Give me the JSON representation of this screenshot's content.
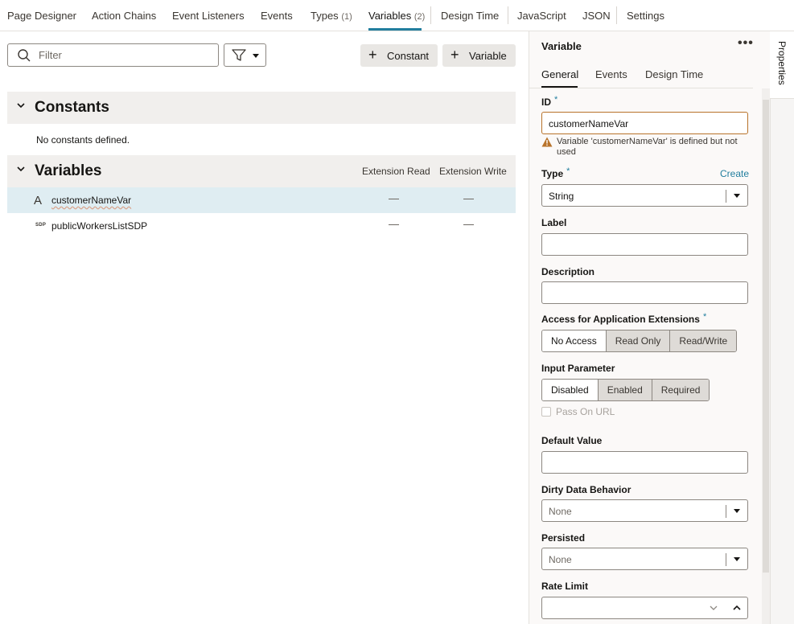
{
  "top_tabs": [
    {
      "label": "Page Designer",
      "count": ""
    },
    {
      "label": "Action Chains",
      "count": ""
    },
    {
      "label": "Event Listeners",
      "count": ""
    },
    {
      "label": "Events",
      "count": ""
    },
    {
      "label": "Types",
      "count": "(1)"
    },
    {
      "label": "Variables",
      "count": "(2)"
    },
    {
      "label": "Design Time",
      "count": ""
    },
    {
      "label": "JavaScript",
      "count": ""
    },
    {
      "label": "JSON",
      "count": ""
    },
    {
      "label": "Settings",
      "count": ""
    }
  ],
  "active_tab": "Variables",
  "toolbar": {
    "filter_placeholder": "Filter",
    "constant_button": "Constant",
    "variable_button": "Variable"
  },
  "constants": {
    "title": "Constants",
    "empty_text": "No constants defined."
  },
  "variables": {
    "title": "Variables",
    "col_read": "Extension Read",
    "col_write": "Extension Write",
    "rows": [
      {
        "icon": "A",
        "name": "customerNameVar",
        "selected": true
      },
      {
        "icon": "SDP",
        "name": "publicWorkersListSDP",
        "selected": false
      }
    ]
  },
  "properties": {
    "title": "Variable",
    "menu": "•••",
    "tabs": [
      "General",
      "Events",
      "Design Time"
    ],
    "id_label": "ID",
    "required_mark": "*",
    "id_value": "customerNameVar",
    "warning": "Variable 'customerNameVar' is defined but not used",
    "type_label": "Type",
    "create_link": "Create",
    "type_value": "String",
    "label_label": "Label",
    "label_value": "",
    "description_label": "Description",
    "description_value": "",
    "access_label": "Access for Application Extensions",
    "access_options": [
      "No Access",
      "Read Only",
      "Read/Write"
    ],
    "access_selected": "No Access",
    "input_param_label": "Input Parameter",
    "input_param_options": [
      "Disabled",
      "Enabled",
      "Required"
    ],
    "input_param_selected": "Disabled",
    "pass_on_url": "Pass On URL",
    "default_value_label": "Default Value",
    "default_value": "",
    "dirty_label": "Dirty Data Behavior",
    "dirty_value": "None",
    "persisted_label": "Persisted",
    "persisted_value": "None",
    "rate_limit_label": "Rate Limit",
    "rate_limit_value": ""
  },
  "side_tab": "Properties",
  "colors": {
    "accent": "#227e9e",
    "selected_row": "#dfedf2",
    "warning": "#b8732b"
  }
}
